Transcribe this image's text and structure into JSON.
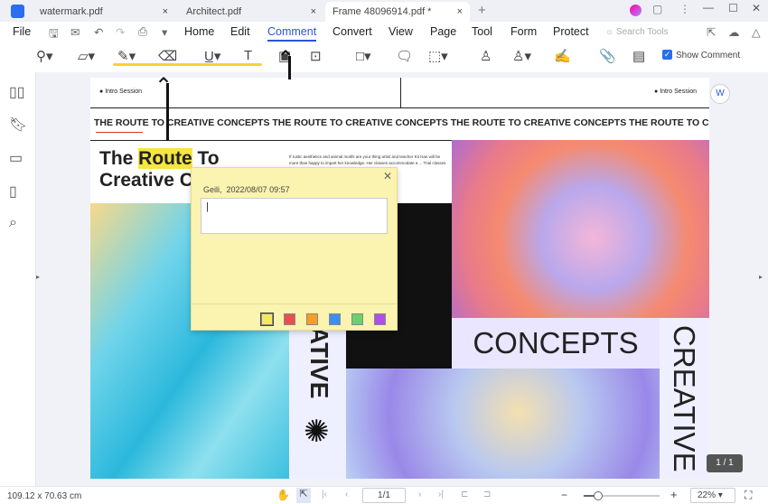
{
  "tabs": [
    {
      "label": "watermark.pdf"
    },
    {
      "label": "Architect.pdf"
    },
    {
      "label": "Frame 48096914.pdf *"
    }
  ],
  "menu": {
    "file": "File",
    "items": [
      "Home",
      "Edit",
      "Comment",
      "Convert",
      "View",
      "Page",
      "Tool",
      "Form",
      "Protect"
    ],
    "active": "Comment",
    "search_placeholder": "Search Tools"
  },
  "toolbar": {
    "show_comment": "Show Comment",
    "show_comment_checked": true
  },
  "document": {
    "intro_left": "Intro Session",
    "intro_right": "Intro Session",
    "banner": "THE ROUTE TO CREATIVE CONCEPTS THE ROUTE TO CREATIVE CONCEPTS THE ROUTE TO CREATIVE CONCEPTS THE ROUTE TO CREATIVE CONCEPTS",
    "title_line1_a": "The ",
    "title_highlight": "Route",
    "title_line1_b": " To",
    "title_line2": "Creative C",
    "paragraph": "If rustic aesthetics and animal motifs are your thing artist and teacher Kit Han will be more than happy to impart her knowledge. Her classes accommodate a ... Trial classes for ... 've gained more ... eaks to be the most",
    "concepts": "CONCEPTS",
    "creative_vertical": "CREATIVE",
    "creative_partial": "ATIVE"
  },
  "note": {
    "author": "Geili,",
    "timestamp": "2022/08/07 09:57",
    "text": "",
    "colors": [
      "#f5e960",
      "#e85050",
      "#f5a020",
      "#3d8ef0",
      "#6cd06c",
      "#b04ee8"
    ]
  },
  "page_badge": "1 / 1",
  "status": {
    "dimensions": "109.12 x 70.63 cm",
    "page_input": "1/1",
    "zoom": "22%",
    "zoom_level_percent": 22
  },
  "accent": "#2a55d8"
}
